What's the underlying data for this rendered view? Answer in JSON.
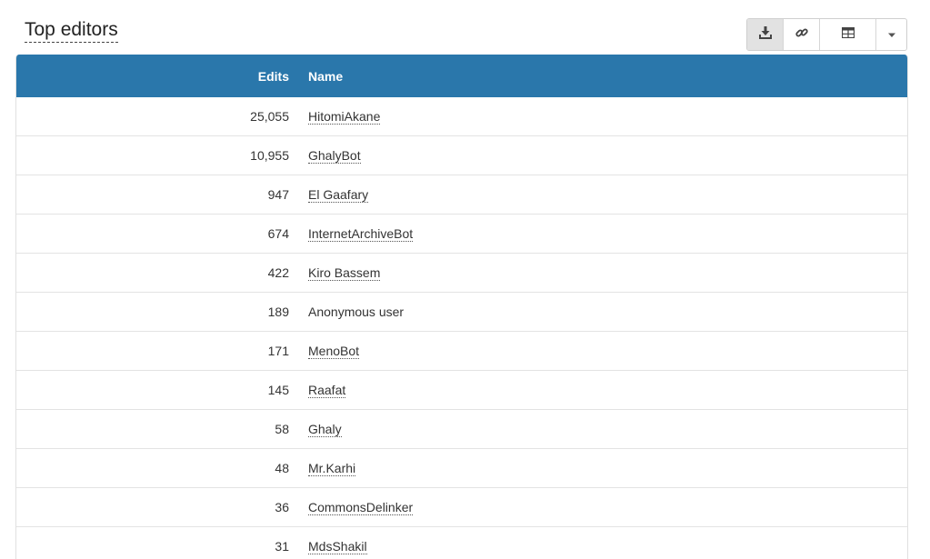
{
  "header": {
    "title": "Top editors"
  },
  "toolbar": {
    "download_icon": "download-icon",
    "link_icon": "link-icon",
    "table_icon": "table-icon",
    "dropdown_icon": "caret-down-icon"
  },
  "table": {
    "columns": {
      "edits": "Edits",
      "name": "Name"
    },
    "rows": [
      {
        "edits": "25,055",
        "name": "HitomiAkane",
        "linked": true
      },
      {
        "edits": "10,955",
        "name": "GhalyBot",
        "linked": true
      },
      {
        "edits": "947",
        "name": "El Gaafary",
        "linked": true
      },
      {
        "edits": "674",
        "name": "InternetArchiveBot",
        "linked": true
      },
      {
        "edits": "422",
        "name": "Kiro Bassem",
        "linked": true
      },
      {
        "edits": "189",
        "name": "Anonymous user",
        "linked": false
      },
      {
        "edits": "171",
        "name": "MenoBot",
        "linked": true
      },
      {
        "edits": "145",
        "name": "Raafat",
        "linked": true
      },
      {
        "edits": "58",
        "name": "Ghaly",
        "linked": true
      },
      {
        "edits": "48",
        "name": "Mr.Karhi",
        "linked": true
      },
      {
        "edits": "36",
        "name": "CommonsDelinker",
        "linked": true
      },
      {
        "edits": "31",
        "name": "MdsShakil",
        "linked": true
      }
    ]
  },
  "colors": {
    "header_bg": "#2a77ab",
    "header_text": "#ffffff",
    "row_border": "#e3e3e3"
  }
}
